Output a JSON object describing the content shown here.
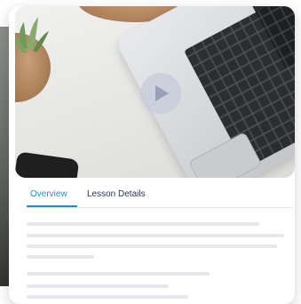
{
  "media": {
    "play_icon": "play-icon"
  },
  "tabs": [
    {
      "label": "Overview",
      "active": true
    },
    {
      "label": "Lesson Details",
      "active": false
    }
  ],
  "colors": {
    "accent": "#1f8fd6",
    "tab_text": "#2c3553",
    "skeleton": "#e7e8eb"
  }
}
